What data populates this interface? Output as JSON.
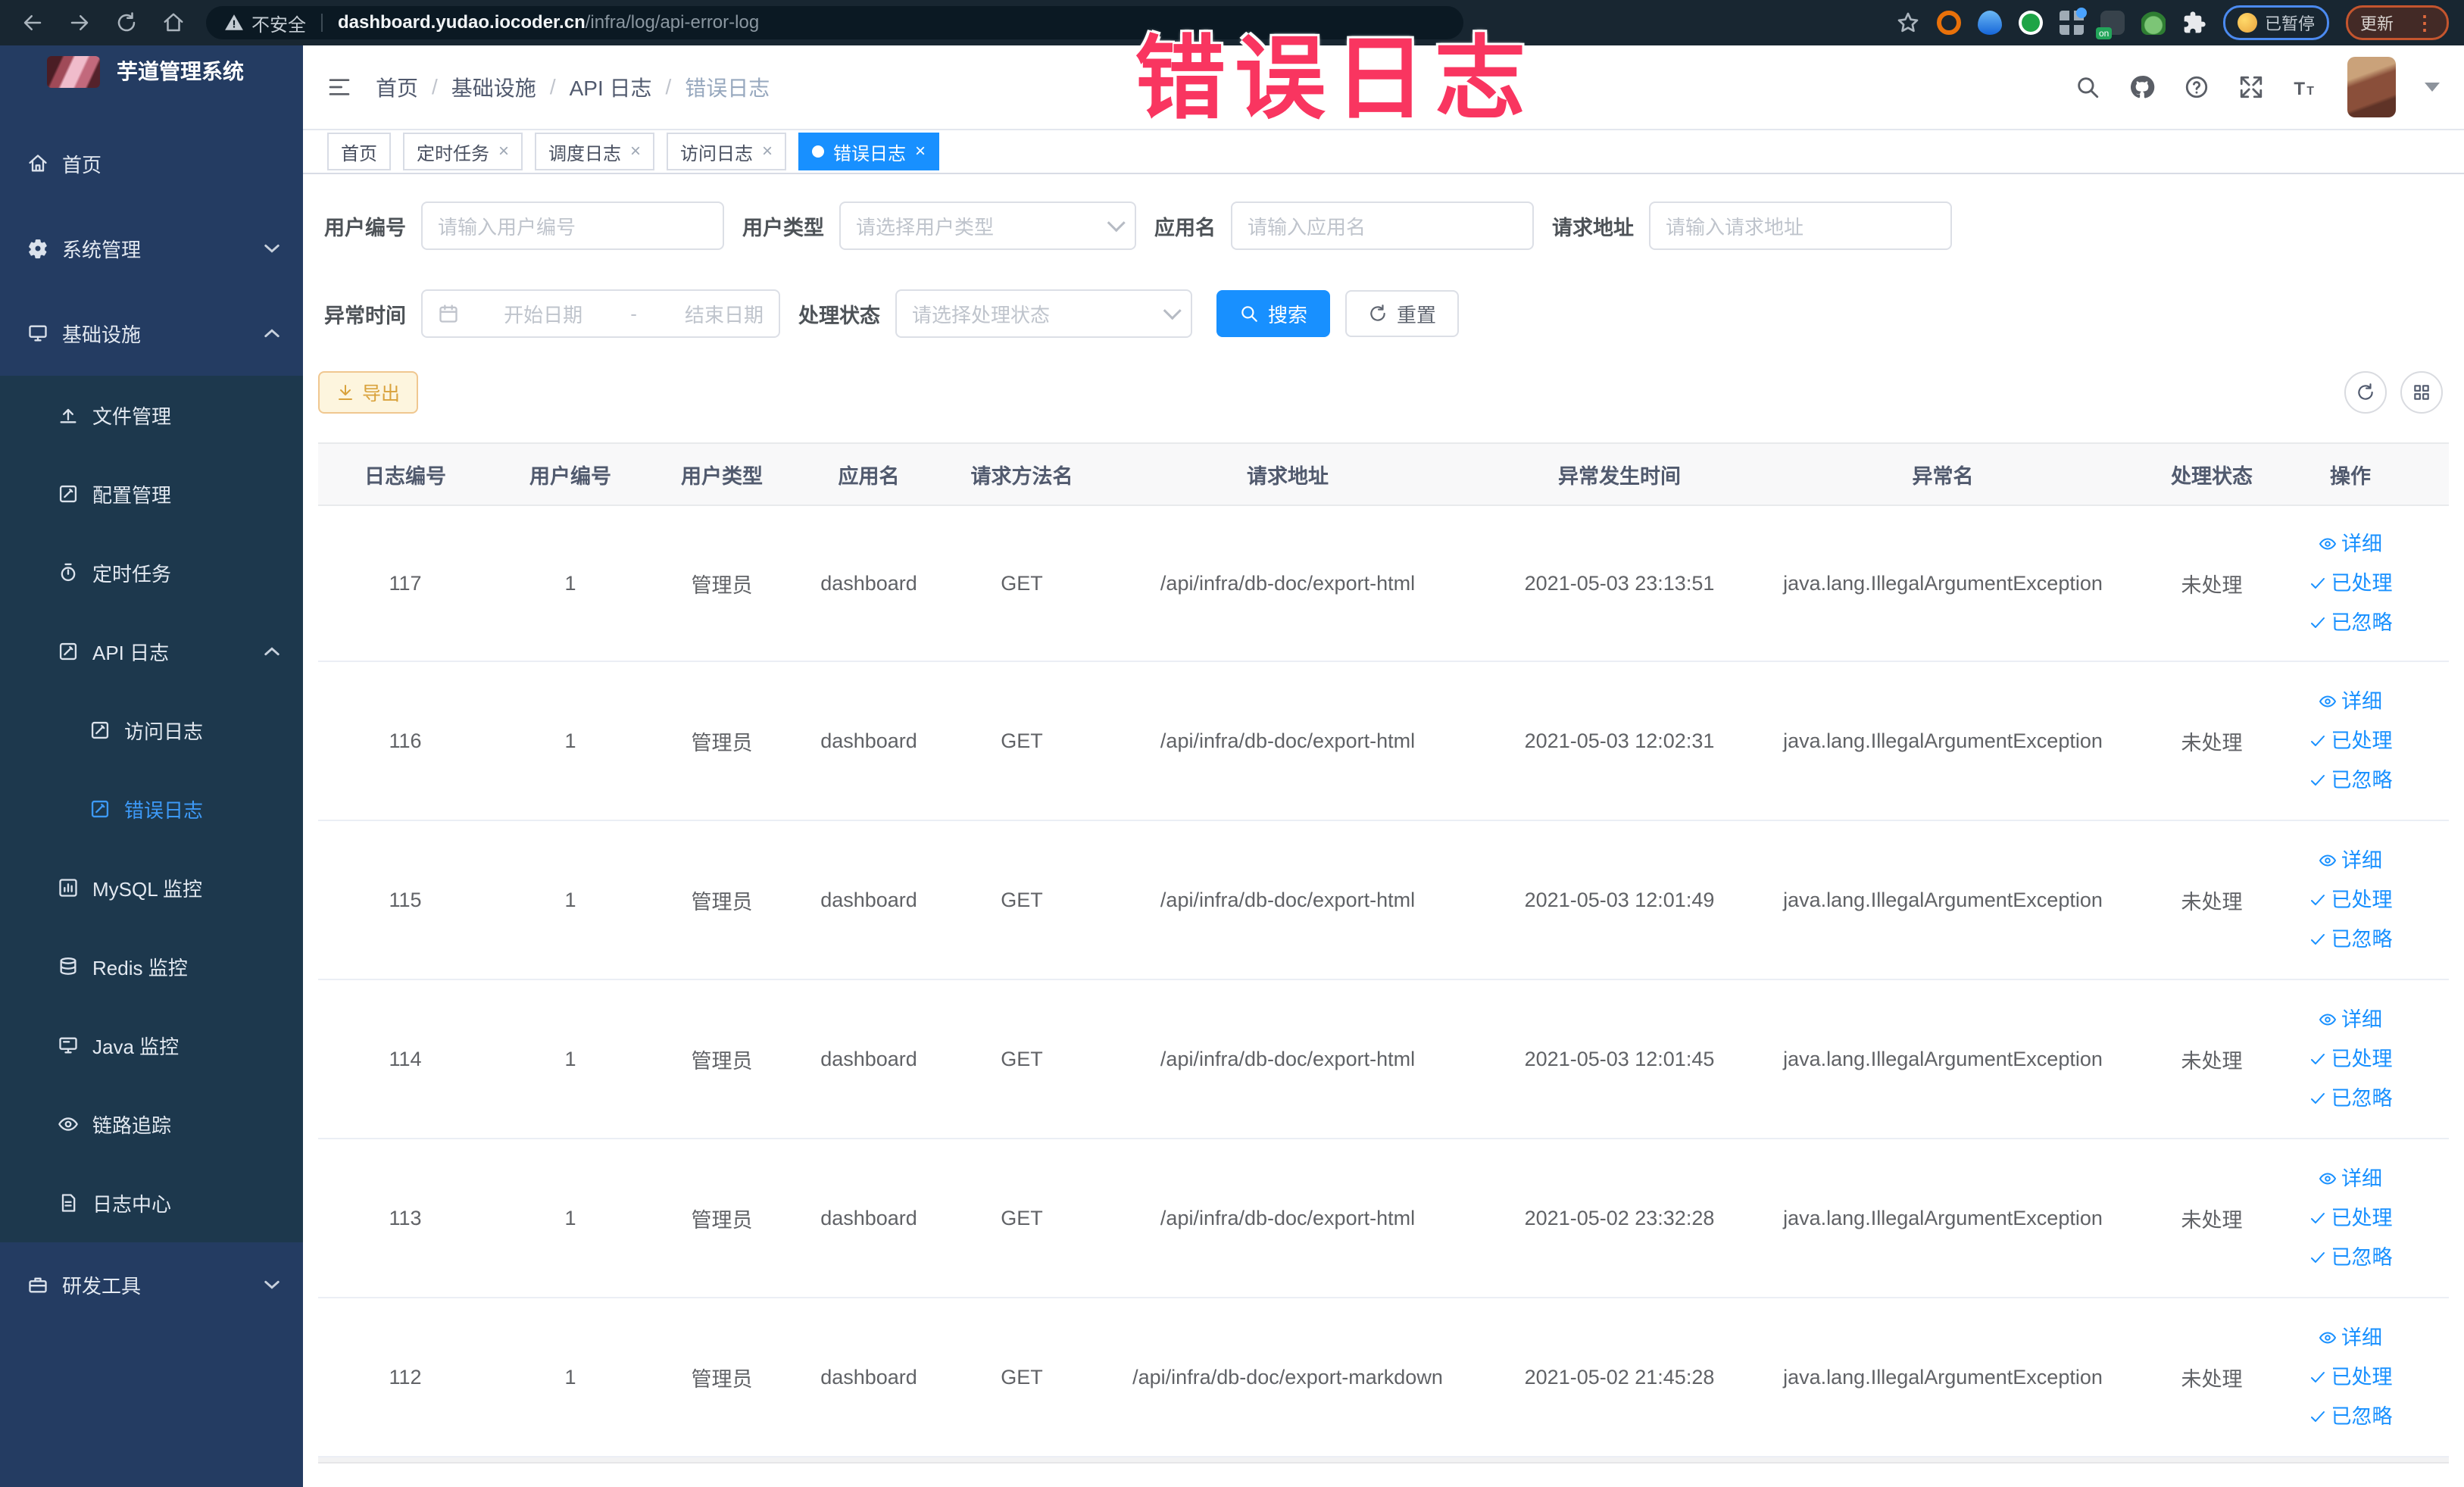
{
  "browser": {
    "security_label": "不安全",
    "url_host": "dashboard.yudao.iocoder.cn",
    "url_path": "/infra/log/api-error-log",
    "paused_label": "已暂停",
    "update_label": "更新"
  },
  "watermark": "错误日志",
  "sidebar": {
    "title": "芋道管理系统",
    "items": [
      {
        "label": "首页",
        "icon": "home-icon",
        "level": 0,
        "sub": false
      },
      {
        "label": "系统管理",
        "icon": "gear-icon",
        "level": 0,
        "sub": false,
        "chevron": "down"
      },
      {
        "label": "基础设施",
        "icon": "monitor-icon",
        "level": 0,
        "sub": false,
        "chevron": "up"
      },
      {
        "label": "文件管理",
        "icon": "upload-icon",
        "level": 1,
        "sub": true
      },
      {
        "label": "配置管理",
        "icon": "edit-icon",
        "level": 1,
        "sub": true
      },
      {
        "label": "定时任务",
        "icon": "timer-icon",
        "level": 1,
        "sub": true
      },
      {
        "label": "API 日志",
        "icon": "log-icon",
        "level": 1,
        "sub": true,
        "chevron": "up"
      },
      {
        "label": "访问日志",
        "icon": "log-icon",
        "level": 2,
        "sub": true
      },
      {
        "label": "错误日志",
        "icon": "log-icon",
        "level": 2,
        "sub": true,
        "active": true
      },
      {
        "label": "MySQL 监控",
        "icon": "chart-icon",
        "level": 1,
        "sub": true
      },
      {
        "label": "Redis 监控",
        "icon": "layers-icon",
        "level": 1,
        "sub": true
      },
      {
        "label": "Java 监控",
        "icon": "display-icon",
        "level": 1,
        "sub": true
      },
      {
        "label": "链路追踪",
        "icon": "eye-icon",
        "level": 1,
        "sub": true
      },
      {
        "label": "日志中心",
        "icon": "doc-icon",
        "level": 1,
        "sub": true
      },
      {
        "label": "研发工具",
        "icon": "toolbox-icon",
        "level": 0,
        "sub": false,
        "chevron": "down"
      }
    ]
  },
  "breadcrumb": [
    "首页",
    "基础设施",
    "API 日志",
    "错误日志"
  ],
  "tabs": [
    {
      "label": "首页",
      "closable": false,
      "active": false
    },
    {
      "label": "定时任务",
      "closable": true,
      "active": false
    },
    {
      "label": "调度日志",
      "closable": true,
      "active": false
    },
    {
      "label": "访问日志",
      "closable": true,
      "active": false
    },
    {
      "label": "错误日志",
      "closable": true,
      "active": true
    }
  ],
  "filters": {
    "user_id_label": "用户编号",
    "user_id_placeholder": "请输入用户编号",
    "user_type_label": "用户类型",
    "user_type_placeholder": "请选择用户类型",
    "app_name_label": "应用名",
    "app_name_placeholder": "请输入应用名",
    "request_url_label": "请求地址",
    "request_url_placeholder": "请输入请求地址",
    "exception_time_label": "异常时间",
    "date_start_placeholder": "开始日期",
    "date_separator": "-",
    "date_end_placeholder": "结束日期",
    "process_status_label": "处理状态",
    "process_status_placeholder": "请选择处理状态",
    "search_label": "搜索",
    "reset_label": "重置"
  },
  "toolbar": {
    "export_label": "导出"
  },
  "table": {
    "columns": [
      "日志编号",
      "用户编号",
      "用户类型",
      "应用名",
      "请求方法名",
      "请求地址",
      "异常发生时间",
      "异常名",
      "处理状态",
      "操作"
    ],
    "rows": [
      [
        "117",
        "1",
        "管理员",
        "dashboard",
        "GET",
        "/api/infra/db-doc/export-html",
        "2021-05-03 23:13:51",
        "java.lang.IllegalArgumentException",
        "未处理"
      ],
      [
        "116",
        "1",
        "管理员",
        "dashboard",
        "GET",
        "/api/infra/db-doc/export-html",
        "2021-05-03 12:02:31",
        "java.lang.IllegalArgumentException",
        "未处理"
      ],
      [
        "115",
        "1",
        "管理员",
        "dashboard",
        "GET",
        "/api/infra/db-doc/export-html",
        "2021-05-03 12:01:49",
        "java.lang.IllegalArgumentException",
        "未处理"
      ],
      [
        "114",
        "1",
        "管理员",
        "dashboard",
        "GET",
        "/api/infra/db-doc/export-html",
        "2021-05-03 12:01:45",
        "java.lang.IllegalArgumentException",
        "未处理"
      ],
      [
        "113",
        "1",
        "管理员",
        "dashboard",
        "GET",
        "/api/infra/db-doc/export-html",
        "2021-05-02 23:32:28",
        "java.lang.IllegalArgumentException",
        "未处理"
      ],
      [
        "112",
        "1",
        "管理员",
        "dashboard",
        "GET",
        "/api/infra/db-doc/export-markdown",
        "2021-05-02 21:45:28",
        "java.lang.IllegalArgumentException",
        "未处理"
      ]
    ],
    "row_actions": [
      "详细",
      "已处理",
      "已忽略"
    ]
  }
}
